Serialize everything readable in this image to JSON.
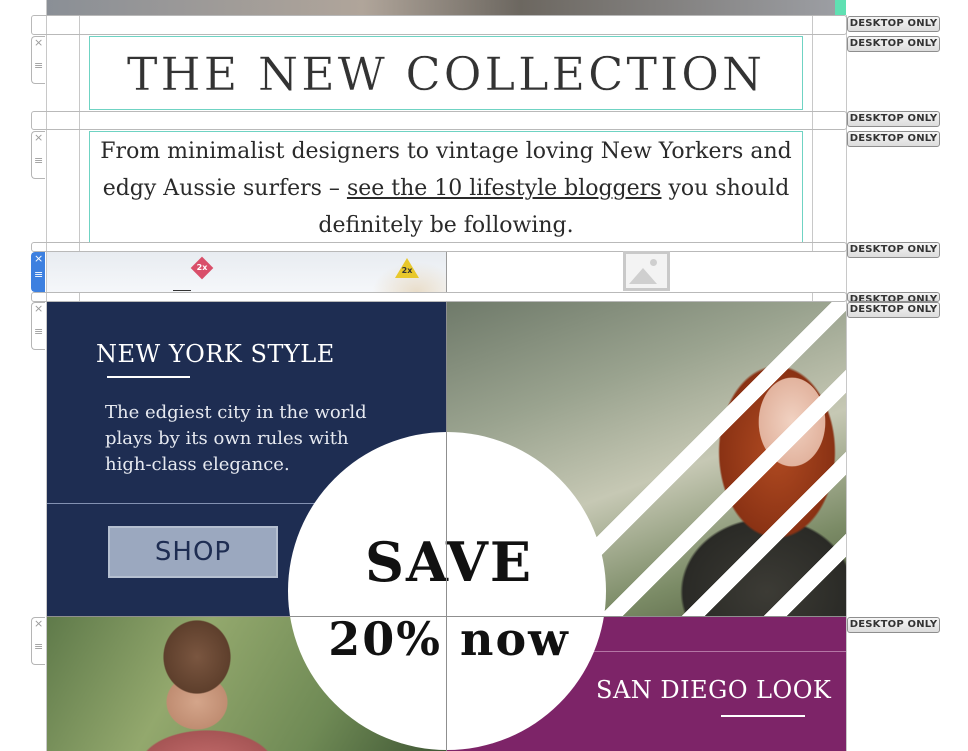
{
  "header": {
    "title": "THE NEW COLLECTION",
    "intro_before": "From minimalist designers to vintage loving New Yorkers and edgy Aussie surfers – ",
    "intro_link": "see the 10 lifestyle bloggers",
    "intro_after": " you should definitely be following."
  },
  "editor": {
    "desktop_only_label": "DESKTOP ONLY",
    "handle_close_glyph": "×",
    "handle_move_glyph": "≡",
    "retina_badge": "2x"
  },
  "new_york": {
    "title": "NEW YORK STYLE",
    "text": "The edgiest city in the world plays by its own rules with high-class elegance.",
    "button": "SHOP"
  },
  "promo": {
    "line1": "SAVE",
    "line2": "20% now"
  },
  "san_diego": {
    "title": "SAN DIEGO LOOK"
  },
  "colors": {
    "navy": "#1e2d52",
    "purple": "#7d2468",
    "teal_guide": "#6fd3c3",
    "handle_active": "#3d80e0"
  }
}
